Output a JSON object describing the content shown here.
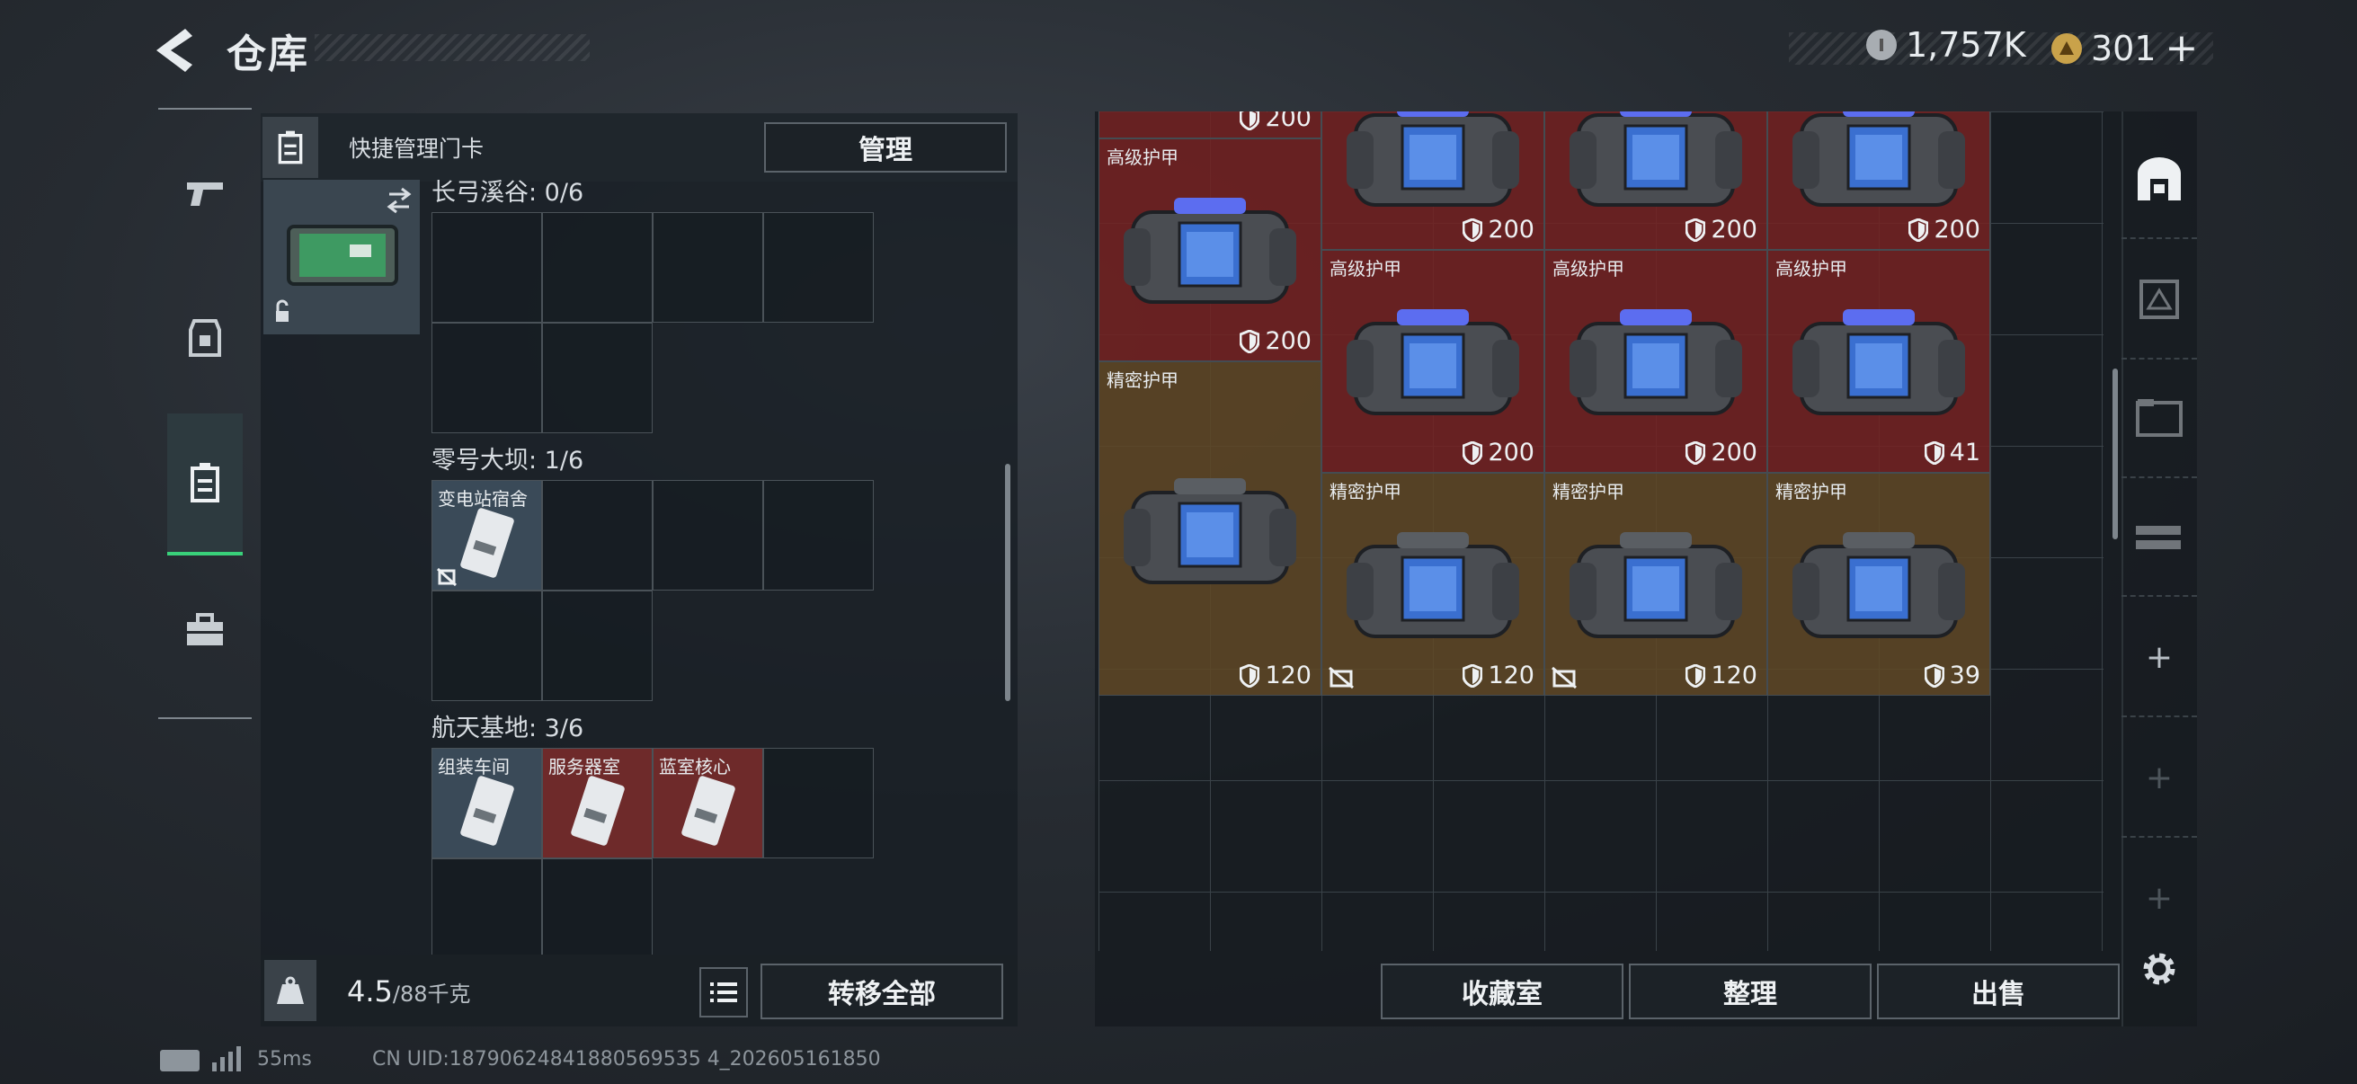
{
  "header": {
    "title": "仓库"
  },
  "currency": {
    "silver": "1,757K",
    "gold": "301",
    "gold_plus": "+"
  },
  "left_panel": {
    "title": "快捷管理门卡",
    "manage_button": "管理",
    "groups": [
      {
        "label": "长弓溪谷: 0/6",
        "slots": []
      },
      {
        "label": "零号大坝: 1/6",
        "slots": [
          "变电站宿舍"
        ]
      },
      {
        "label": "航天基地: 3/6",
        "slots": [
          "组装车间",
          "服务器室",
          "蓝室核心"
        ]
      }
    ],
    "weight": {
      "value": "4.5",
      "max": "/88千克"
    },
    "transfer_all_button": "转移全部"
  },
  "items": [
    {
      "name": "",
      "value": "200",
      "color": "red"
    },
    {
      "name": "高级护甲",
      "value": "200",
      "color": "red"
    },
    {
      "name": "高级护甲",
      "value": "200",
      "color": "red"
    },
    {
      "name": "高级护甲",
      "value": "200",
      "color": "red"
    },
    {
      "name": "精密护甲",
      "value": "120",
      "color": "amber"
    },
    {
      "name": "高级护甲",
      "value": "200",
      "color": "red"
    },
    {
      "name": "高级护甲",
      "value": "200",
      "color": "red"
    },
    {
      "name": "高级护甲",
      "value": "41",
      "color": "red"
    },
    {
      "name": "精密护甲",
      "value": "120",
      "color": "amber"
    },
    {
      "name": "精密护甲",
      "value": "120",
      "color": "amber"
    },
    {
      "name": "精密护甲",
      "value": "39",
      "color": "amber"
    },
    {
      "name": "高级护甲",
      "value": "200",
      "color": "red"
    }
  ],
  "right_buttons": {
    "collection": "收藏室",
    "sort": "整理",
    "sell": "出售"
  },
  "status_bar": {
    "ping": "55ms",
    "uid": "CN UID:18790624841880569535 4_202605161850"
  },
  "side_plus": "+"
}
